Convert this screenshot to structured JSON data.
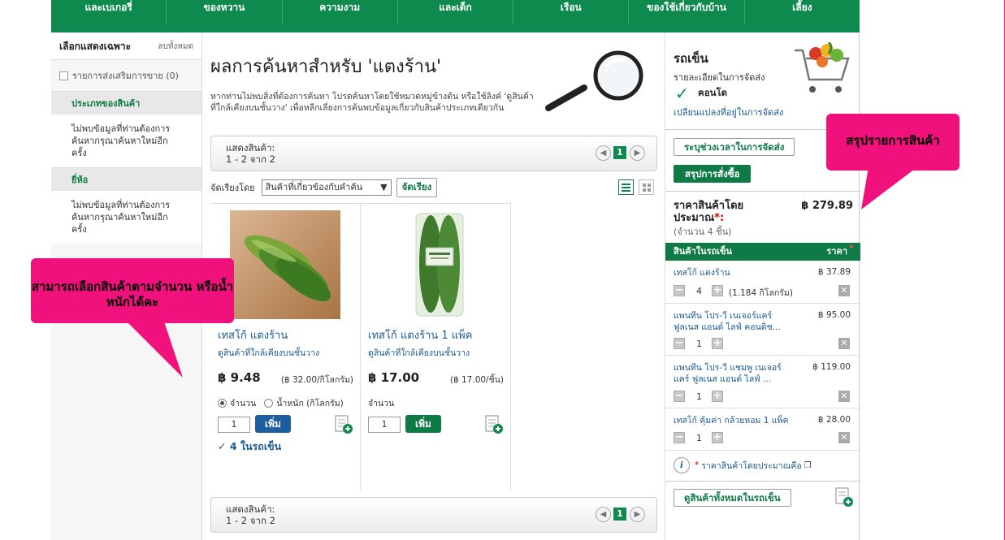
{
  "topnav": [
    "และเบเกอรี่",
    "ของหวาน",
    "ความงาม",
    "และเด็ก",
    "เรือน",
    "ของใช้เกี่ยวกับบ้าน",
    "เลี้ยง"
  ],
  "left": {
    "title": "เลือกแสดงเฉพาะ",
    "clear": "ลบทั้งหมด",
    "promo_label": "รายการส่งเสริมการขาย",
    "promo_count": "(0)",
    "section_category": "ประเภทของสินค้า",
    "no_data_1": "ไม่พบข้อมูลที่ท่านต้องการ ค้นหากรุณาค้นหาใหม่อีกครั้ง",
    "section_brand": "ยี่ห้อ",
    "no_data_2": "ไม่พบข้อมูลที่ท่านต้องการ ค้นหากรุณาค้นหาใหม่อีกครั้ง"
  },
  "main": {
    "heading": "ผลการค้นหาสำหรับ 'แตงร้าน'",
    "description": "หากท่านไม่พบสิ่งที่ต้องการค้นหา โปรดค้นหาโดยใช้หมวดหมู่ข้างต้น หรือใช้ลิงค์ 'ดูสินค้าที่ใกล้เคียงบนชั้นวาง' เพื่อหลีกเลี่ยงการค้นพบข้อมูลเกี่ยวกับสินค้าประเภทเดียวกัน",
    "pager": {
      "label": "แสดงสินค้า:",
      "range": "1 - 2  จาก  2",
      "page": "1",
      "prev": "◀",
      "next": "▶"
    },
    "sort_label": "จัดเรียงโดย",
    "sort_value": "สินค้าที่เกี่ยวข้องกับคำค้น",
    "sort_button": "จัดเรียง"
  },
  "products": [
    {
      "title": "เทสโก้ แตงร้าน",
      "similar": "ดูสินค้าที่ใกล้เคียงบนชั้นวาง",
      "price": "฿ 9.48",
      "unit_price": "(฿ 32.00/กิโลกรัม)",
      "opt_qty": "จำนวน",
      "opt_weight": "น้ำหนัก (กิโลกรัม)",
      "qty": "1",
      "add": "เพิ่ม",
      "in_cart": "4 ในรถเข็น",
      "add_color": "#1f5e9e"
    },
    {
      "title": "เทสโก้ แตงร้าน 1 แพ็ค",
      "similar": "ดูสินค้าที่ใกล้เคียงบนชั้นวาง",
      "price": "฿ 17.00",
      "unit_price": "(฿ 17.00/ชิ้น)",
      "opt_qty": "จำนวน",
      "qty": "1",
      "add": "เพิ่ม",
      "add_color": "#0e7a46"
    }
  ],
  "cart": {
    "title": "รถเข็น",
    "delivery_detail": "รายละเอียดในการจัดส่ง",
    "place": "คอนโด",
    "change_address": "เปลี่ยนแปลงที่อยู่ในการจัดส่ง",
    "slot_button": "ระบุช่วงเวลาในการจัดส่ง",
    "checkout_button": "สรุปการสั่งซื้อ",
    "est_label": "ราคาสินค้าโดยประมาณ",
    "est_star": "*:",
    "est_count": "(จำนวน 4 ชิ้น)",
    "est_total": "฿ 279.89",
    "col_item": "สินค้าในรถเข็น",
    "col_price": "ราคา",
    "col_star": "*",
    "items": [
      {
        "name": "เทสโก้ แตงร้าน",
        "price": "฿ 37.89",
        "qty": "4",
        "weight": "(1.184 กิโลกรัม)"
      },
      {
        "name": "แพนทีน โปร-วี เนเจอร์แคร์ ฟูลเนส แอนด์ ไลฟ์ คอนดิช...",
        "price": "฿ 95.00",
        "qty": "1"
      },
      {
        "name": "แพนทีน โปร-วี แชมพู เนเจอร์แคร์ ฟูลเนส แอนด์ ไลฟ์ ...",
        "price": "฿ 119.00",
        "qty": "1"
      },
      {
        "name": "เทสโก้ คุ้มค่า กล้วยหอม 1 แพ็ค",
        "price": "฿ 28.00",
        "qty": "1"
      }
    ],
    "info_star": "*",
    "info_text": "ราคาสินค้าโดยประมาณคือ",
    "view_all": "ดูสินค้าทั้งหมดในรถเข็น"
  },
  "callouts": {
    "left": "สามารถเลือกสินค้าตามจำนวน หรือน้ำหนักได้คะ",
    "right": "สรุปรายการสินค้า"
  }
}
